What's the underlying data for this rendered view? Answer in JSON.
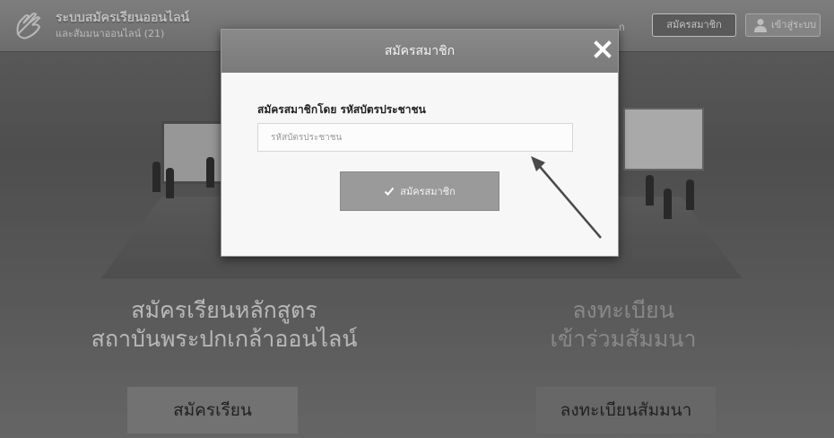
{
  "header": {
    "site_title": "ระบบสมัครเรียนออนไลน์",
    "site_subtitle": "และสัมมนาออนไลน์ (21)",
    "partial_text": "ก",
    "register_button": "สมัครสมาชิก",
    "login_button": "เข้าสู่ระบบ",
    "icons": [
      "pointing-hand-icon",
      "user-icon"
    ]
  },
  "main": {
    "left_title_line1": "สมัครเรียนหลักสูตร",
    "left_title_line2": "สถาบันพระปกเกล้าออนไลน์",
    "right_title_line1": "ลงทะเบียน",
    "right_title_line2": "เข้าร่วมสัมมนา",
    "enroll_button": "สมัครเรียน",
    "seminar_button": "ลงทะเบียนสัมมนา"
  },
  "modal": {
    "title": "สมัครสมาชิก",
    "close_symbol": "✕",
    "field_label": "สมัครสมาชิกโดย รหัสบัตรประชาชน",
    "id_input_placeholder": "รหัสบัตรประชาชน",
    "id_input_value": "",
    "submit_label": "สมัครสมาชิก",
    "icons": [
      "close-icon",
      "check-icon"
    ]
  }
}
